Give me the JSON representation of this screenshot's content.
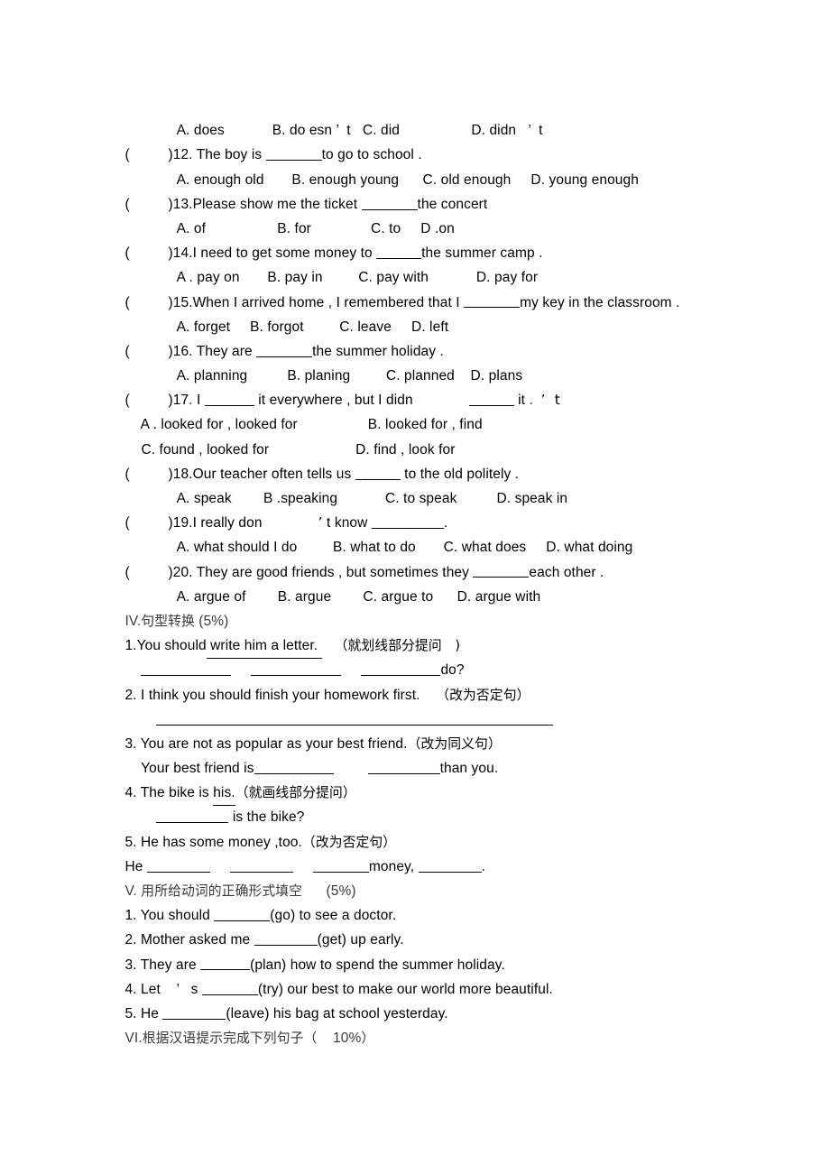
{
  "document": {
    "type": "english-exam-worksheet",
    "language": "en-zh"
  },
  "multiple_choice": {
    "q11_options_line": "A. does            B. do esn ’  t   C. did                  D. didn   ’  t",
    "questions": [
      {
        "marker_open": "(",
        "marker_close": ")",
        "number": "12. ",
        "stem_before": "The boy is ",
        "stem_after": "to go to school .",
        "options_line": "A. enough old       B. enough young      C. old enough     D. young enough"
      },
      {
        "marker_open": "(",
        "marker_close": ")",
        "number": "13.",
        "stem_before": "Please show me the ticket ",
        "stem_after": "the concert",
        "options_line": "A. of                  B. for               C. to     D .on"
      },
      {
        "marker_open": "(",
        "marker_close": ")",
        "number": "14.",
        "stem_before": "I need to get some money to ",
        "stem_after": "the summer camp .",
        "options_line": "A . pay on       B. pay in         C. pay with            D. pay for"
      },
      {
        "marker_open": "(",
        "marker_close": ")",
        "number": "15.",
        "stem_before": "When I arrived home , I remembered that I ",
        "stem_after": "my key in the classroom .",
        "options_line": "A. forget     B. forgot         C. leave     D. left"
      },
      {
        "marker_open": "(",
        "marker_close": ")",
        "number": "16. ",
        "stem_before": "They are ",
        "stem_after": "the summer holiday .",
        "options_line": "A. planning          B. planing         C. planned    D. plans"
      }
    ],
    "q17": {
      "marker_open": "(",
      "marker_close": ")",
      "number": "17. ",
      "part1": "I ",
      "part2": " it everywhere , but I didn",
      "part3": " it .  ",
      "trailing_apostrophe": "’  t",
      "option_a": "A . looked for , looked for",
      "option_b": "B. looked for , find",
      "option_c": "C. found , looked for",
      "option_d": "D. find , look for"
    },
    "q18": {
      "marker_open": "(",
      "marker_close": ")",
      "number": "18.",
      "stem_before": "Our teacher often tells us ",
      "stem_after": " to the old politely .",
      "options_line": "A. speak        B .speaking            C. to speak          D. speak in"
    },
    "q19": {
      "marker_open": "(",
      "marker_close": ")",
      "number": "19.",
      "part1": "I really don",
      "apostrophe": "’",
      "part2": " t know ",
      "part3": ".",
      "options_line": "A. what should I do         B. what to do       C. what does     D. what doing"
    },
    "q20": {
      "marker_open": "(",
      "marker_close": ")",
      "number": "20. ",
      "stem_before": "They are good friends , but sometimes they ",
      "stem_after": "each other .",
      "options_line": "A. argue of        B. argue        C. argue to      D. argue with"
    }
  },
  "section_iv": {
    "heading_numeral": "IV.",
    "heading_cn": "句型转换",
    "heading_score": " (5%)",
    "items": [
      {
        "number": "1.",
        "text_before": "You should",
        "underlined": " write him a letter. ",
        "instruction": "（就划线部分提问   )",
        "answer_suffix": "do?"
      },
      {
        "number": "2. ",
        "text": "I think you should finish your homework first.    ",
        "instruction": "（改为否定句）"
      },
      {
        "number": "3. ",
        "text": "You are not as popular as your best friend.",
        "instruction": "（改为同义句）",
        "answer_before": "Your best friend is",
        "answer_after": "than you."
      },
      {
        "number": "4. ",
        "text_before": "The bike is ",
        "underlined": "his.",
        "instruction": "（就画线部分提问）",
        "answer_after": " is the bike?"
      },
      {
        "number": "5. ",
        "text": "He has some money ,too.",
        "instruction": "（改为否定句）",
        "answer_start": "He ",
        "answer_mid": "money, ",
        "answer_end": "."
      }
    ]
  },
  "section_v": {
    "heading_numeral": "V. ",
    "heading_cn": "用所给动词的正确形式填空",
    "heading_score": "      (5%)",
    "items": [
      {
        "number": "1. ",
        "before": "You should ",
        "after": "(go) to see a doctor."
      },
      {
        "number": "2. ",
        "before": "Mother asked me ",
        "after": "(get) up early."
      },
      {
        "number": "3. ",
        "before": "They are ",
        "after": "(plan) how to spend the summer holiday."
      },
      {
        "number": "4. ",
        "before": "Let    ’   s ",
        "after": "(try) our best to make our world more beautiful."
      },
      {
        "number": "5. ",
        "before": "He ",
        "after": "(leave) his bag at school yesterday."
      }
    ]
  },
  "section_vi": {
    "heading_numeral": "VI.",
    "heading_cn": "根据汉语提示完成下列句子（",
    "heading_score": "    10%",
    "heading_cn_end": "）"
  }
}
